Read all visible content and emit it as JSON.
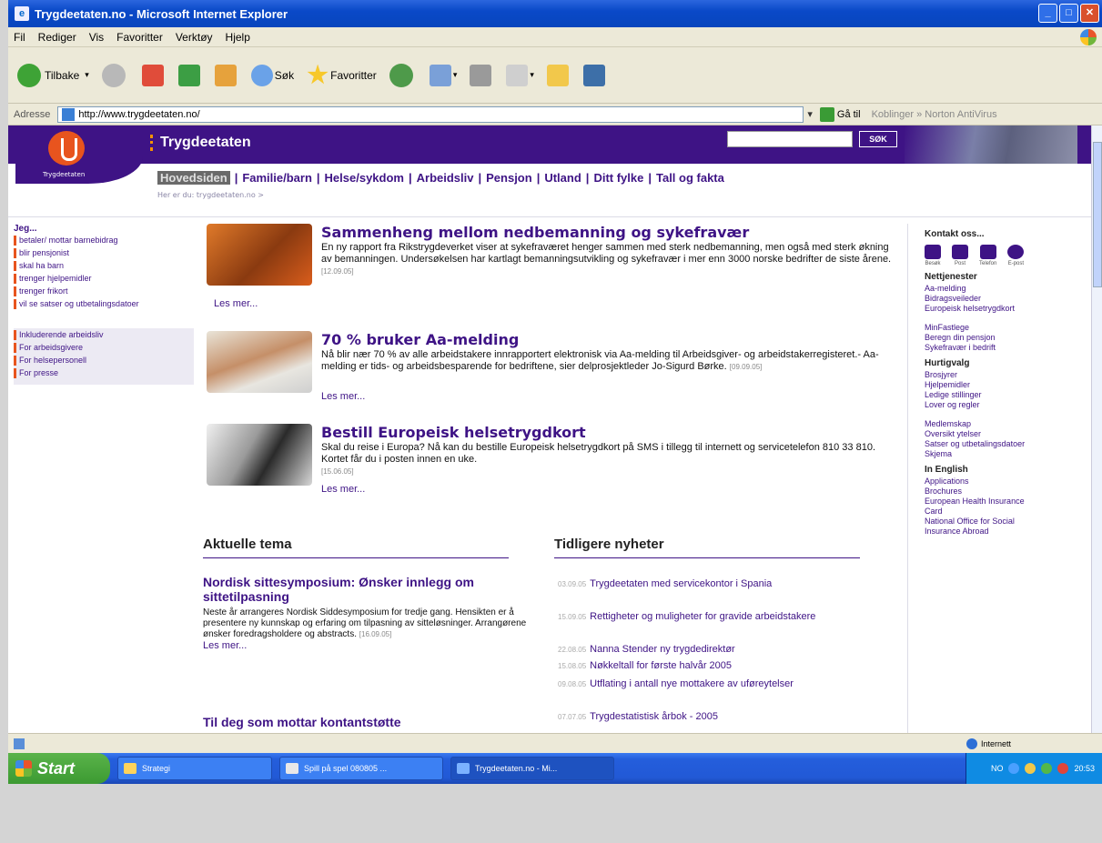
{
  "window": {
    "title": "Trygdeetaten.no - Microsoft Internet Explorer",
    "buttons": [
      "_",
      "□",
      "✕"
    ]
  },
  "menu": [
    "Fil",
    "Rediger",
    "Vis",
    "Favoritter",
    "Verktøy",
    "Hjelp"
  ],
  "toolbar": {
    "back": "Tilbake",
    "search": "Søk",
    "favorites": "Favoritter"
  },
  "address": {
    "label": "Adresse",
    "url": "http://www.trygdeetaten.no/",
    "go": "Gå til",
    "extras": "Koblinger  »  Norton AntiVirus"
  },
  "site": {
    "brand": "Trygdeetaten",
    "logo_text": "Trygdeetaten",
    "search_button": "SØK",
    "nav": [
      "Hovedsiden",
      "Familie/barn",
      "Helse/sykdom",
      "Arbeidsliv",
      "Pensjon",
      "Utland",
      "Ditt fylke",
      "Tall og fakta"
    ],
    "subnav": "Her er du: trygdeetaten.no >"
  },
  "left": {
    "heading": "Jeg...",
    "items": [
      "betaler/ mottar barnebidrag",
      "blir pensjonist",
      "skal ha barn",
      "trenger hjelpemidler",
      "trenger frikort",
      "vil se satser og utbetalingsdatoer"
    ],
    "items2": [
      "Inkluderende arbeidsliv",
      "For arbeidsgivere",
      "For helsepersonell",
      "For presse"
    ]
  },
  "news": [
    {
      "title": "Sammenheng mellom nedbemanning og sykefravær",
      "text": "En ny rapport fra Rikstrygdeverket viser at sykefraværet henger sammen med sterk nedbemanning, men også med sterk økning av bemanningen. Undersøkelsen har kartlagt bemanningsutvikling og sykefravær i mer enn 3000 norske bedrifter de siste årene.",
      "date": "[12.09.05]",
      "more": "Les mer..."
    },
    {
      "title": "70 % bruker Aa-melding",
      "text": "Nå blir nær 70 % av alle arbeidstakere innrapportert elektronisk via Aa-melding til Arbeidsgiver- og arbeidstakerregisteret.- Aa-melding er tids- og arbeidsbesparende for bedriftene, sier delprosjektleder Jo-Sigurd Børke.",
      "date": "[09.09.05]",
      "more": "Les mer..."
    },
    {
      "title": "Bestill Europeisk helsetrygdkort",
      "text": "Skal du reise i Europa? Nå kan du bestille Europeisk helsetrygdkort på SMS i tillegg til internett og servicetelefon 810 33 810. Kortet får du i posten innen en uke.",
      "date": "[15.06.05]",
      "more": "Les mer..."
    }
  ],
  "aktuelle": {
    "heading": "Aktuelle tema",
    "items": [
      {
        "title": "Nordisk sittesymposium: Ønsker innlegg om sittetilpasning",
        "text": "Neste år arrangeres Nordisk Siddesymposium for tredje gang. Hensikten er å presentere ny kunnskap og erfaring om tilpasning av sitteløsninger. Arrangørene ønsker foredragsholdere og abstracts.",
        "date": "[16.09.05]",
        "more": "Les mer..."
      },
      {
        "title": "Til deg som mottar kontantstøtte"
      }
    ]
  },
  "tidligere": {
    "heading": "Tidligere nyheter",
    "items": [
      {
        "date": "03.09.05",
        "text": "Trygdeetaten med servicekontor i Spania"
      },
      {
        "date": "15.09.05",
        "text": "Rettigheter og muligheter for gravide arbeidstakere"
      },
      {
        "date": "22.08.05",
        "text": "Nanna Stender ny trygdedirektør"
      },
      {
        "date": "15.08.05",
        "text": "Nøkkeltall for første halvår 2005"
      },
      {
        "date": "09.08.05",
        "text": "Utflating i antall nye mottakere av uføreytelser"
      },
      {
        "date": "07.07.05",
        "text": "Trygdestatistisk årbok - 2005"
      }
    ]
  },
  "right": {
    "contact_heading": "Kontakt oss...",
    "contact_icons": [
      "Besøk",
      "Post",
      "Telefon",
      "E-post"
    ],
    "nett_heading": "Nettjenester",
    "nett": [
      "Aa-melding",
      "Bidragsveileder",
      "Europeisk helsetrygdkort"
    ],
    "nett2": [
      "MinFastlege",
      "Beregn din pensjon",
      "Sykefravær i bedrift"
    ],
    "hurtig_heading": "Hurtigvalg",
    "hurtig": [
      "Brosjyrer",
      "Hjelpemidler",
      "Ledige stillinger",
      "Lover og regler"
    ],
    "hurtig2": [
      "Medlemskap",
      "Oversikt ytelser",
      "Satser og utbetalingsdatoer",
      "Skjema"
    ],
    "english_heading": "In English",
    "english": [
      "Applications",
      "Brochures",
      "European Health Insurance Card",
      "National Office for Social Insurance Abroad"
    ]
  },
  "status": {
    "zone": "Internett"
  },
  "taskbar": {
    "start": "Start",
    "tasks": [
      "Strategi",
      "Spill på spel 080805 ...",
      "Trygdeetaten.no - Mi..."
    ],
    "clock": "20:53",
    "lang": "NO"
  }
}
